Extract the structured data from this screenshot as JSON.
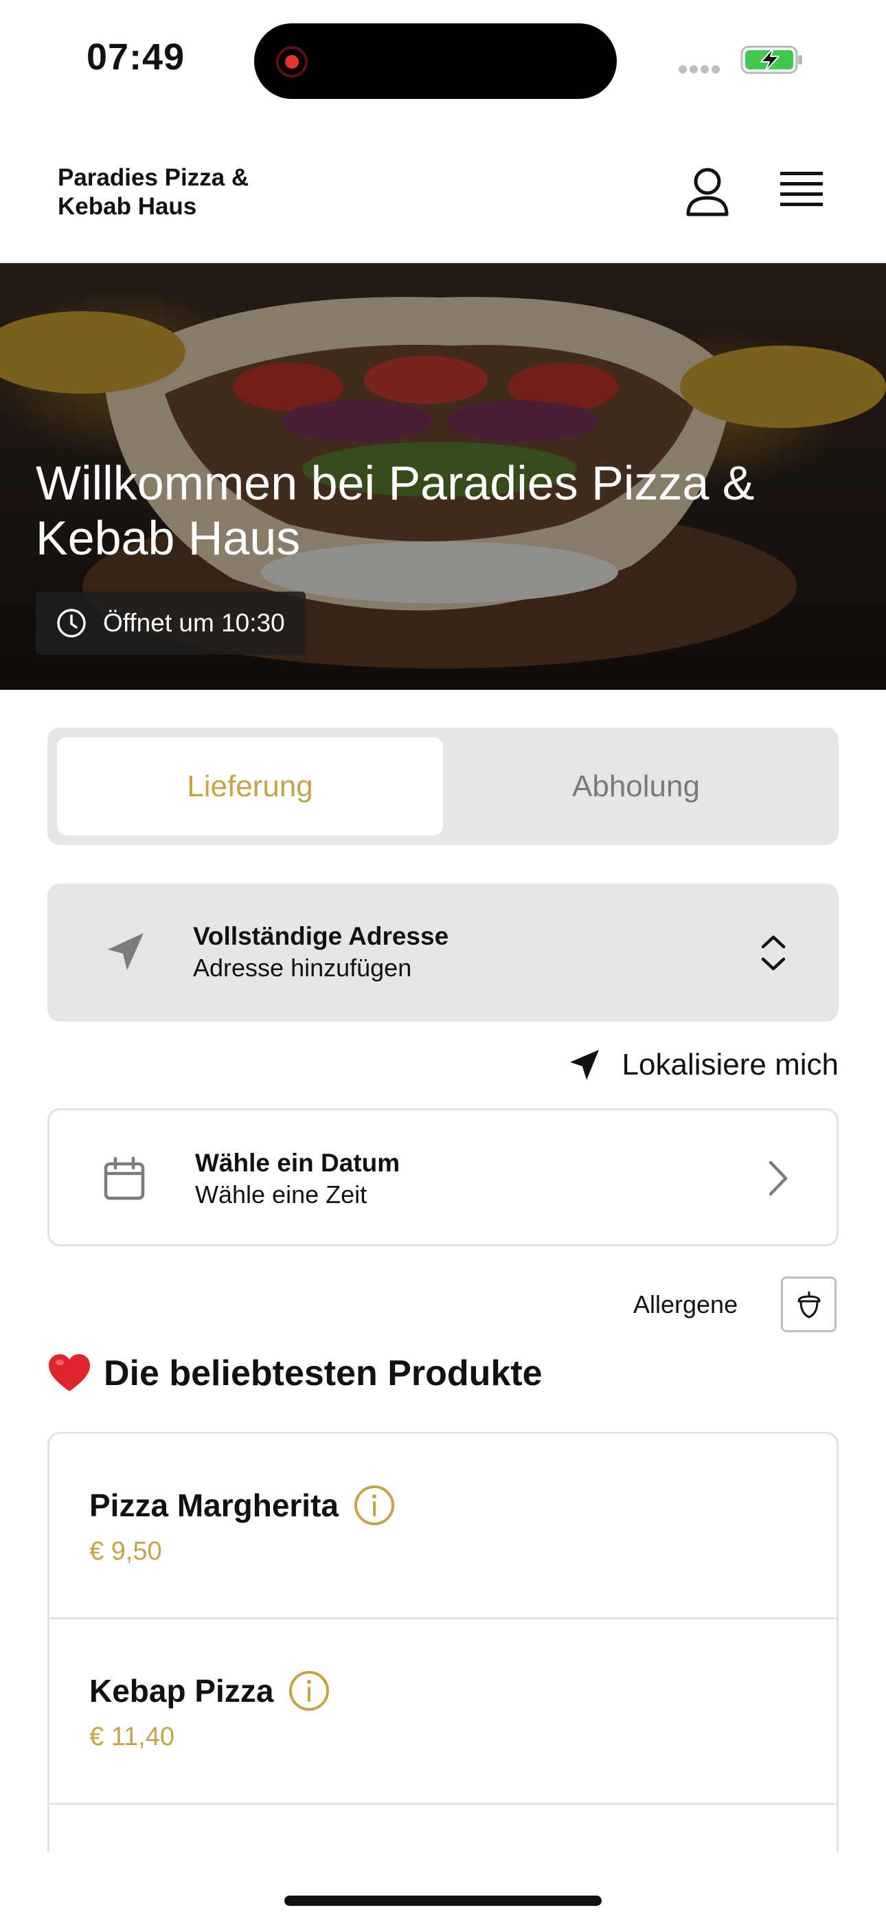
{
  "status_bar": {
    "time": "07:49"
  },
  "header": {
    "brand": "Paradies Pizza & Kebab Haus",
    "profile_icon": "user-icon",
    "menu_icon": "hamburger-menu-icon"
  },
  "hero": {
    "title": "Willkommen bei Paradies Pizza & Kebab Haus",
    "opening": "Öffnet um 10:30"
  },
  "order_mode": {
    "options": [
      "Lieferung",
      "Abholung"
    ],
    "selected": "Lieferung"
  },
  "address": {
    "title": "Vollständige Adresse",
    "subtitle": "Adresse hinzufügen"
  },
  "locate": {
    "label": "Lokalisiere mich"
  },
  "schedule": {
    "title": "Wähle ein Datum",
    "subtitle": "Wähle eine Zeit"
  },
  "allergens": {
    "label": "Allergene"
  },
  "popular": {
    "title": "Die beliebtesten Produkte",
    "items": [
      {
        "name": "Pizza Margherita",
        "price": "€ 9,50"
      },
      {
        "name": "Kebap Pizza",
        "price": "€ 11,40"
      }
    ]
  },
  "colors": {
    "accent": "#c4a448",
    "panel": "#e6e6e6",
    "border": "#e2e2e2"
  }
}
